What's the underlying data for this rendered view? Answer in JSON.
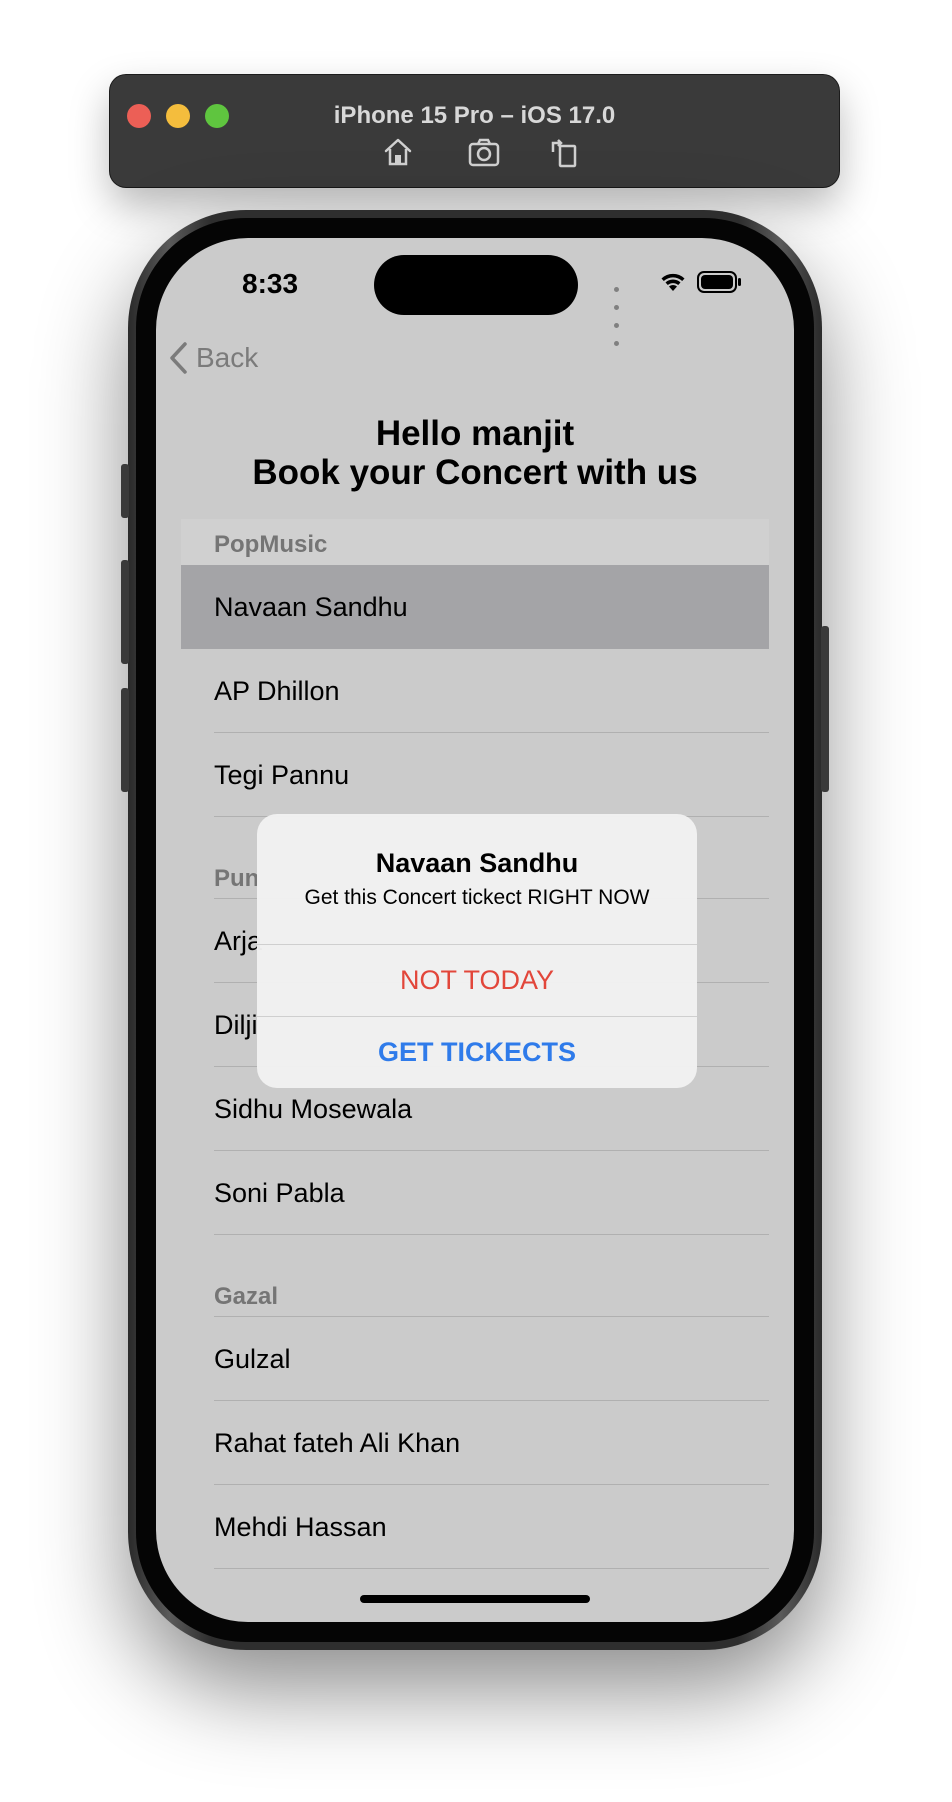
{
  "simulator": {
    "title": "iPhone 15 Pro – iOS 17.0",
    "icons": [
      "home-icon",
      "screenshot-icon",
      "rotate-icon"
    ]
  },
  "status_bar": {
    "time": "8:33"
  },
  "nav": {
    "back_label": "Back"
  },
  "header": {
    "line1": "Hello manjit",
    "line2": "Book your Concert with us"
  },
  "sections": [
    {
      "title": "PopMusic",
      "items": [
        "Navaan Sandhu",
        "AP Dhillon",
        "Tegi Pannu"
      ],
      "selected": "Navaan Sandhu"
    },
    {
      "title": "Pun",
      "items": [
        "Arja",
        "Dilji",
        "Sidhu Mosewala",
        "Soni Pabla"
      ]
    },
    {
      "title": "Gazal",
      "items": [
        "Gulzal",
        "Rahat fateh Ali Khan",
        "Mehdi Hassan"
      ]
    }
  ],
  "alert": {
    "title": "Navaan Sandhu",
    "message": "Get this Concert tickect RIGHT NOW",
    "cancel_label": "NOT TODAY",
    "confirm_label": "GET TICKECTS"
  },
  "colors": {
    "destructive": "#e2463a",
    "accent": "#2f7bea",
    "overlay_background": "#cbcbcb"
  }
}
